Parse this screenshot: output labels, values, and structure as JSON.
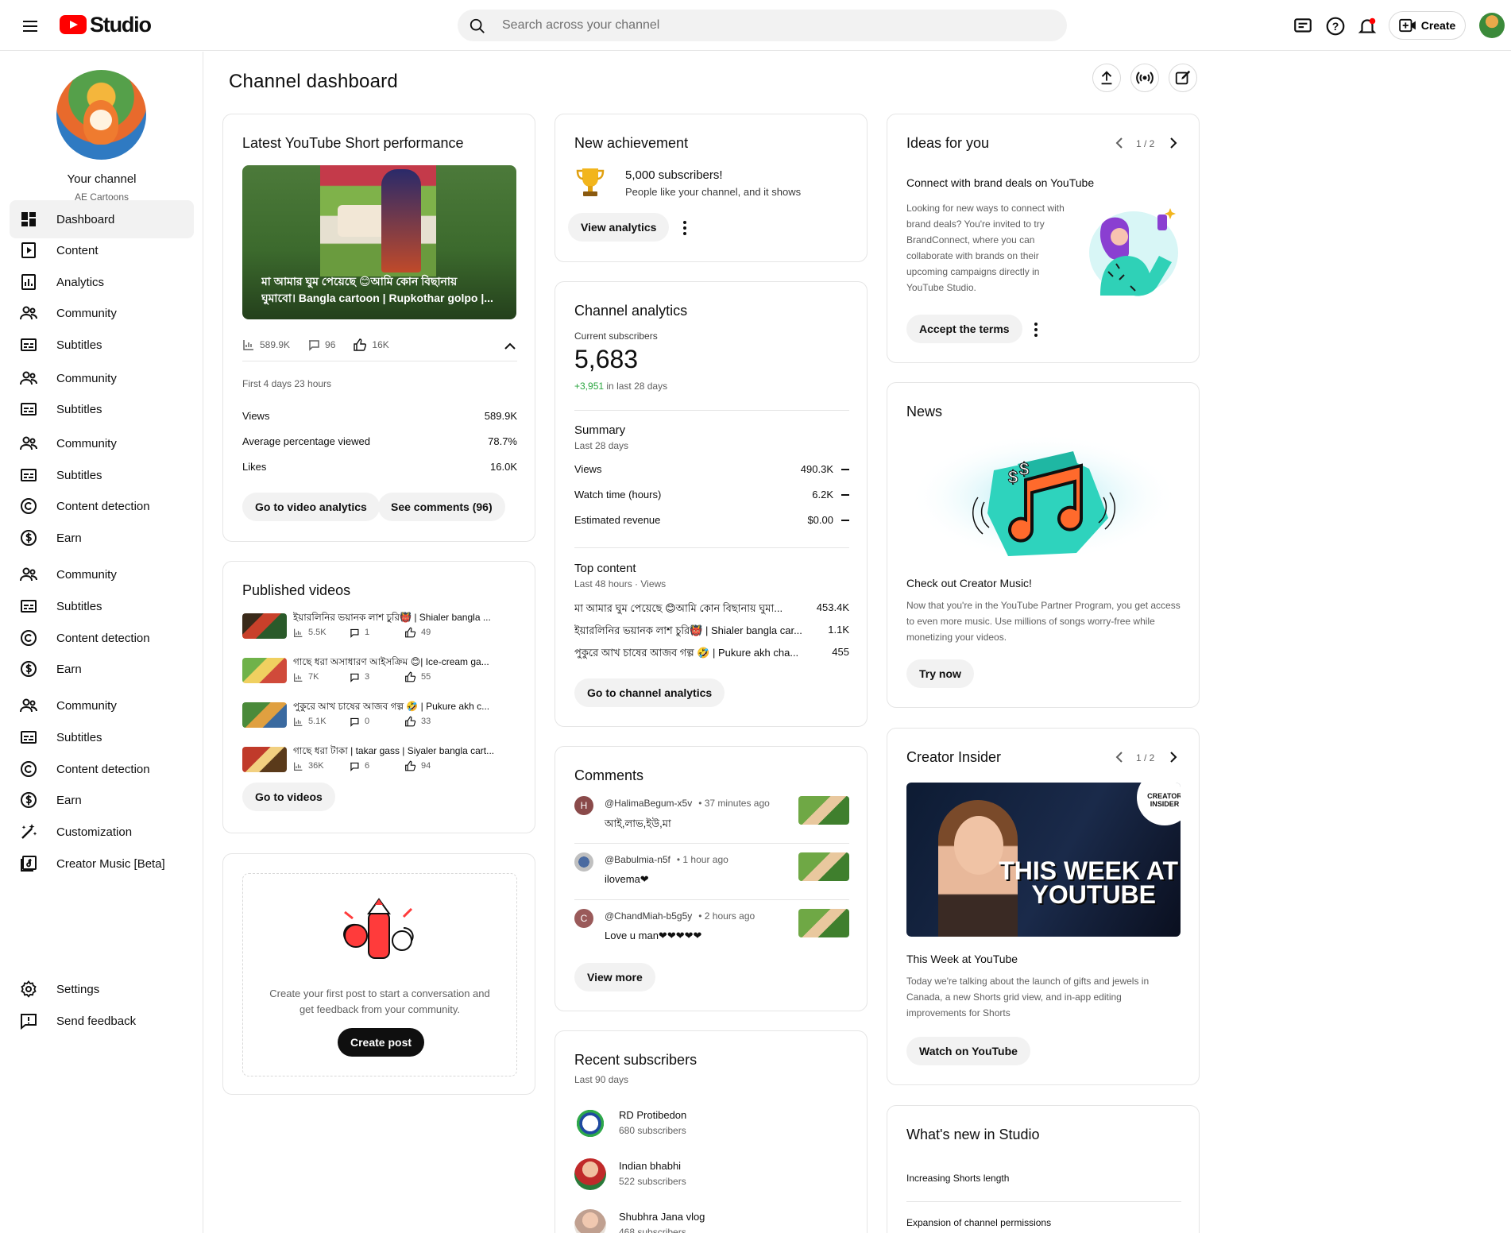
{
  "app": {
    "title": "Studio"
  },
  "search": {
    "placeholder": "Search across your channel"
  },
  "header": {
    "create_label": "Create"
  },
  "sidebar": {
    "channel_title": "Your channel",
    "channel_name": "AE Cartoons",
    "items": [
      {
        "label": "Dashboard",
        "icon": "dashboard-icon"
      },
      {
        "label": "Content",
        "icon": "content-icon"
      },
      {
        "label": "Analytics",
        "icon": "analytics-icon"
      },
      {
        "label": "Community",
        "icon": "community-icon"
      },
      {
        "label": "Subtitles",
        "icon": "subtitles-icon"
      },
      {
        "label": "Community",
        "icon": "community-icon"
      },
      {
        "label": "Subtitles",
        "icon": "subtitles-icon"
      },
      {
        "label": "Community",
        "icon": "community-icon"
      },
      {
        "label": "Subtitles",
        "icon": "subtitles-icon"
      },
      {
        "label": "Content detection",
        "icon": "copyright-icon"
      },
      {
        "label": "Earn",
        "icon": "earn-icon"
      },
      {
        "label": "Community",
        "icon": "community-icon"
      },
      {
        "label": "Subtitles",
        "icon": "subtitles-icon"
      },
      {
        "label": "Content detection",
        "icon": "copyright-icon"
      },
      {
        "label": "Earn",
        "icon": "earn-icon"
      },
      {
        "label": "Community",
        "icon": "community-icon"
      },
      {
        "label": "Subtitles",
        "icon": "subtitles-icon"
      },
      {
        "label": "Content detection",
        "icon": "copyright-icon"
      },
      {
        "label": "Earn",
        "icon": "earn-icon"
      },
      {
        "label": "Customization",
        "icon": "customization-icon"
      },
      {
        "label": "Creator Music [Beta]",
        "icon": "creator-music-icon"
      }
    ],
    "bottom": [
      {
        "label": "Settings",
        "icon": "settings-icon"
      },
      {
        "label": "Send feedback",
        "icon": "feedback-icon"
      }
    ]
  },
  "page": {
    "title": "Channel dashboard"
  },
  "short_perf": {
    "title": "Latest YouTube Short performance",
    "video_title_line1": "মা আমার ঘুম পেয়েছে 😊আমি কোন বিছানায়",
    "video_title_line2": "ঘুমাবো। Bangla cartoon | Rupkothar golpo |...",
    "views": "589.9K",
    "comments": "96",
    "likes": "16K",
    "period": "First 4 days 23 hours",
    "rows": [
      {
        "label": "Views",
        "value": "589.9K"
      },
      {
        "label": "Average percentage viewed",
        "value": "78.7%"
      },
      {
        "label": "Likes",
        "value": "16.0K"
      }
    ],
    "btn_analytics": "Go to video analytics",
    "btn_comments": "See comments (96)"
  },
  "published": {
    "title": "Published videos",
    "videos": [
      {
        "title": "ইয়ারলিনির ভয়ানক লাশ চুরি👹 | Shialer bangla ...",
        "views": "5.5K",
        "comments": "1",
        "likes": "49"
      },
      {
        "title": "গাছে ধরা অসাধারণ আইসক্রিম 😊| Ice-cream ga...",
        "views": "7K",
        "comments": "3",
        "likes": "55"
      },
      {
        "title": "পুকুরে আখ চাষের আজব গল্প 🤣 | Pukure akh c...",
        "views": "5.1K",
        "comments": "0",
        "likes": "33"
      },
      {
        "title": "গাছে ধরা টাকা | takar gass | Siyaler bangla cart...",
        "views": "36K",
        "comments": "6",
        "likes": "94"
      }
    ],
    "btn": "Go to videos"
  },
  "post": {
    "text": "Create your first post to start a conversation and get feedback from your community.",
    "btn": "Create post"
  },
  "achievement": {
    "title": "New achievement",
    "headline": "5,000 subscribers!",
    "sub": "People like your channel, and it shows",
    "btn": "View analytics"
  },
  "analytics": {
    "title": "Channel analytics",
    "subs_label": "Current subscribers",
    "subs_value": "5,683",
    "subs_delta": "+3,951",
    "subs_delta_suffix": "in last 28 days",
    "summary_title": "Summary",
    "summary_period": "Last 28 days",
    "summary_rows": [
      {
        "label": "Views",
        "value": "490.3K"
      },
      {
        "label": "Watch time (hours)",
        "value": "6.2K"
      },
      {
        "label": "Estimated revenue",
        "value": "$0.00"
      }
    ],
    "top_title": "Top content",
    "top_period": "Last 48 hours · Views",
    "top_rows": [
      {
        "label": "মা আমার ঘুম পেয়েছে 😊আমি কোন বিছানায় ঘুমা...",
        "value": "453.4K"
      },
      {
        "label": "ইয়ারলিনির ভয়ানক লাশ চুরি👹 | Shialer bangla car...",
        "value": "1.1K"
      },
      {
        "label": "পুকুরে আখ চাষের আজব গল্প 🤣 | Pukure akh cha...",
        "value": "455"
      }
    ],
    "btn": "Go to channel analytics"
  },
  "comments": {
    "title": "Comments",
    "items": [
      {
        "initial": "H",
        "author": "@HalimaBegum-x5v",
        "time": "• 37 minutes ago",
        "text": "আই,লাভ,ইউ,মা"
      },
      {
        "initial": "",
        "author": "@Babulmia-n5f",
        "time": "• 1 hour ago",
        "text": "ilovema❤"
      },
      {
        "initial": "C",
        "author": "@ChandMiah-b5g5y",
        "time": "• 2 hours ago",
        "text": "Love u man❤❤❤❤❤"
      }
    ],
    "btn": "View more"
  },
  "recent_subs": {
    "title": "Recent subscribers",
    "period": "Last 90 days",
    "items": [
      {
        "name": "RD Protibedon",
        "subs": "680 subscribers"
      },
      {
        "name": "Indian bhabhi",
        "subs": "522 subscribers"
      },
      {
        "name": "Shubhra Jana vlog",
        "subs": "468 subscribers"
      }
    ]
  },
  "ideas": {
    "title": "Ideas for you",
    "pager": "1 / 2",
    "headline": "Connect with brand deals on YouTube",
    "body": "Looking for new ways to connect with brand deals? You're invited to try BrandConnect, where you can collaborate with brands on their upcoming campaigns directly in YouTube Studio.",
    "btn": "Accept the terms"
  },
  "news": {
    "title": "News",
    "headline": "Check out Creator Music!",
    "body": "Now that you're in the YouTube Partner Program, you get access to even more music. Use millions of songs worry-free while monetizing your videos.",
    "btn": "Try now"
  },
  "insider": {
    "title": "Creator Insider",
    "pager": "1 / 2",
    "badge_line1": "CREATOR",
    "badge_line2": "INSIDER",
    "overlay_line1": "THIS WEEK AT",
    "overlay_line2": "YOUTUBE",
    "headline": "This Week at YouTube",
    "body": "Today we're talking about the launch of gifts and jewels in Canada, a new Shorts grid view, and in-app editing improvements for Shorts",
    "btn": "Watch on YouTube"
  },
  "whats_new": {
    "title": "What's new in Studio",
    "items": [
      "Increasing Shorts length",
      "Expansion of channel permissions"
    ]
  },
  "colors": {
    "brand_red": "#ff0000",
    "accent_green": "#2ba640",
    "text": "#0f0f0f",
    "muted": "#606060"
  }
}
